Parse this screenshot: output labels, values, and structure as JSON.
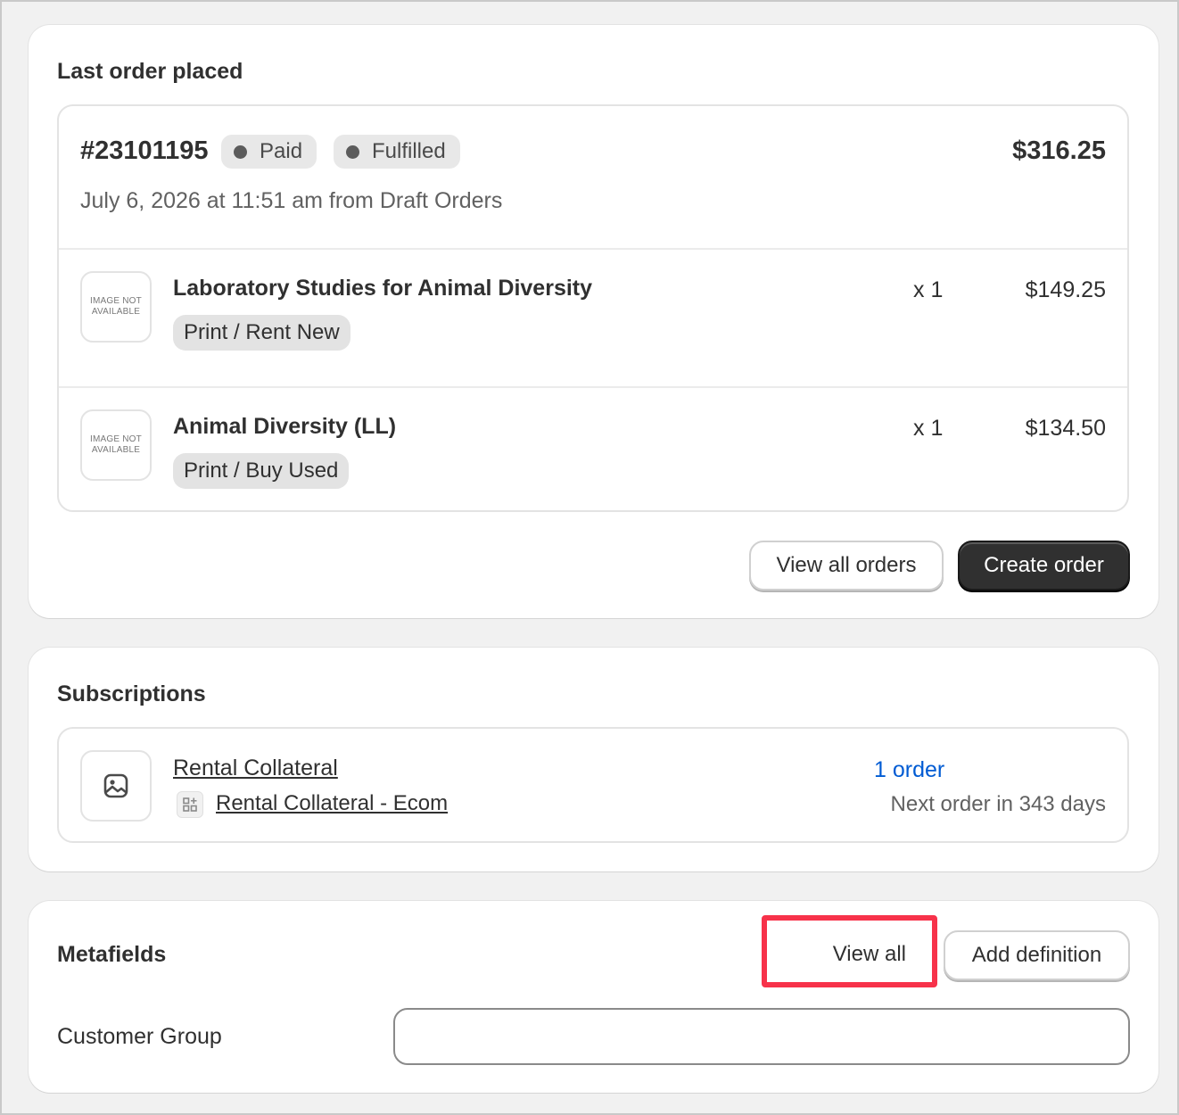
{
  "last_order": {
    "title": "Last order placed",
    "order_number": "#23101195",
    "badges": [
      "Paid",
      "Fulfilled"
    ],
    "total": "$316.25",
    "subtitle": "July 6, 2026 at 11:51 am from Draft Orders",
    "items": [
      {
        "thumb_text": "IMAGE NOT AVAILABLE",
        "name": "Laboratory Studies for Animal Diversity",
        "variant": "Print / Rent New",
        "qty": "x 1",
        "price": "$149.25"
      },
      {
        "thumb_text": "IMAGE NOT AVAILABLE",
        "name": "Animal Diversity (LL)",
        "variant": "Print / Buy Used",
        "qty": "x 1",
        "price": "$134.50"
      }
    ],
    "view_all_orders_label": "View all orders",
    "create_order_label": "Create order"
  },
  "subscriptions": {
    "title": "Subscriptions",
    "item": {
      "name": "Rental Collateral",
      "sub_name": "Rental Collateral - Ecom",
      "orders": "1 order",
      "next_order": "Next order in 343 days"
    }
  },
  "metafields": {
    "title": "Metafields",
    "view_all_label": "View all",
    "add_definition_label": "Add definition",
    "fields": [
      {
        "label": "Customer Group",
        "value": ""
      }
    ]
  },
  "colors": {
    "highlight": "#f7324a",
    "link_blue": "#005bd3",
    "primary_button": "#303030"
  }
}
